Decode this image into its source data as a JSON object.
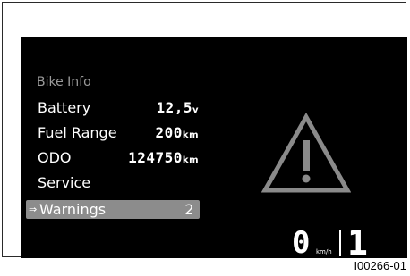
{
  "menu": {
    "heading": "Bike Info",
    "items": [
      {
        "label": "Battery",
        "value": "12,5",
        "unit": "v"
      },
      {
        "label": "Fuel Range",
        "value": "200",
        "unit": "km"
      },
      {
        "label": "ODO",
        "value": "124750",
        "unit": "km"
      },
      {
        "label": "Service",
        "value": "",
        "unit": ""
      },
      {
        "label": "Warnings",
        "value": "2",
        "unit": "",
        "selected": true,
        "marker": "⇒"
      }
    ]
  },
  "status": {
    "warning_icon": "warning-triangle-icon",
    "speed": "0",
    "speed_unit": "km/h",
    "gear": "1"
  },
  "figure_id": "I00266-01",
  "colors": {
    "screen_bg": "#000000",
    "text": "#ffffff",
    "heading": "#9a9a9a",
    "selected_bg": "#8c8c8c",
    "icon_stroke": "#8a8a8a"
  }
}
